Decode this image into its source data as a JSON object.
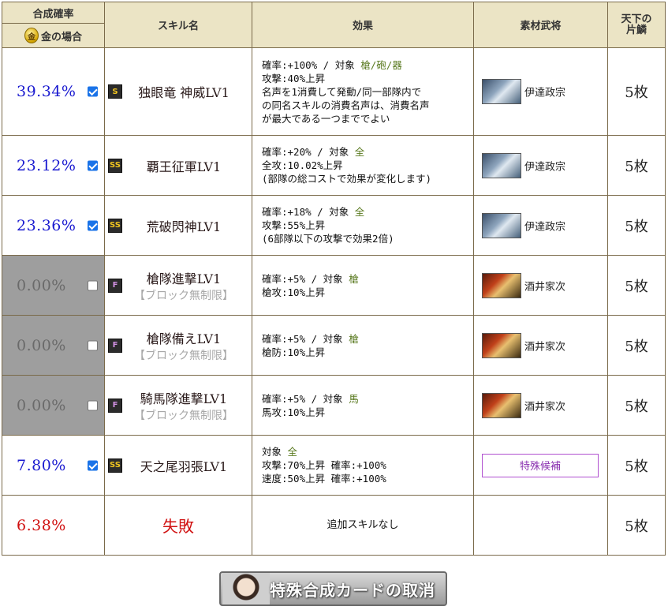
{
  "header": {
    "rate": "合成確率",
    "gold_icon": "金",
    "gold_case": "金の場合",
    "skill_name": "スキル名",
    "effect": "効果",
    "material": "素材武将",
    "scale_line1": "天下の",
    "scale_line2": "片鱗"
  },
  "rows": [
    {
      "rate": "39.34%",
      "checked": true,
      "enabled": true,
      "rank": "S",
      "skill": "独眼竜 神威LV1",
      "note": "",
      "effect": [
        "確率:+100% / 対象 ",
        "攻撃:40%上昇",
        "名声を1消費して発動/同一部隊内で",
        "の同名スキルの消費名声は、消費名声",
        "が最大である一つまででよい"
      ],
      "target": "槍/砲/器",
      "general": "伊達政宗",
      "portrait": "blue",
      "scale": "5枚"
    },
    {
      "rate": "23.12%",
      "checked": true,
      "enabled": true,
      "rank": "SS",
      "skill": "覇王征軍LV1",
      "note": "",
      "effect": [
        "確率:+20% / 対象 ",
        "全攻:10.02%上昇",
        "(部隊の総コストで効果が変化します)"
      ],
      "target": "全",
      "general": "伊達政宗",
      "portrait": "blue",
      "scale": "5枚"
    },
    {
      "rate": "23.36%",
      "checked": true,
      "enabled": true,
      "rank": "SS",
      "skill": "荒破閃神LV1",
      "note": "",
      "effect": [
        "確率:+18% / 対象 ",
        "攻撃:55%上昇",
        "(6部隊以下の攻撃で効果2倍)"
      ],
      "target": "全",
      "general": "伊達政宗",
      "portrait": "blue",
      "scale": "5枚"
    },
    {
      "rate": "0.00%",
      "checked": false,
      "enabled": false,
      "rank": "F",
      "skill": "槍隊進撃LV1",
      "note": "【ブロック無制限】",
      "effect": [
        "確率:+5% / 対象 ",
        "槍攻:10%上昇"
      ],
      "target": "槍",
      "general": "酒井家次",
      "portrait": "red",
      "scale": "5枚"
    },
    {
      "rate": "0.00%",
      "checked": false,
      "enabled": false,
      "rank": "F",
      "skill": "槍隊備えLV1",
      "note": "【ブロック無制限】",
      "effect": [
        "確率:+5% / 対象 ",
        "槍防:10%上昇"
      ],
      "target": "槍",
      "general": "酒井家次",
      "portrait": "red",
      "scale": "5枚"
    },
    {
      "rate": "0.00%",
      "checked": false,
      "enabled": false,
      "rank": "F",
      "skill": "騎馬隊進撃LV1",
      "note": "【ブロック無制限】",
      "effect": [
        "確率:+5% / 対象 ",
        "馬攻:10%上昇"
      ],
      "target": "馬",
      "general": "酒井家次",
      "portrait": "red",
      "scale": "5枚"
    },
    {
      "rate": "7.80%",
      "checked": true,
      "enabled": true,
      "rank": "SS",
      "skill": "天之尾羽張LV1",
      "note": "",
      "effect": [
        "対象 ",
        "攻撃:70%上昇 確率:+100%",
        "速度:50%上昇 確率:+100%"
      ],
      "target": "全",
      "special_button": "特殊候補",
      "scale": "5枚"
    }
  ],
  "fail_row": {
    "rate": "6.38%",
    "label": "失敗",
    "effect": "追加スキルなし",
    "scale": "5枚"
  },
  "cancel_button": "特殊合成カードの取消"
}
